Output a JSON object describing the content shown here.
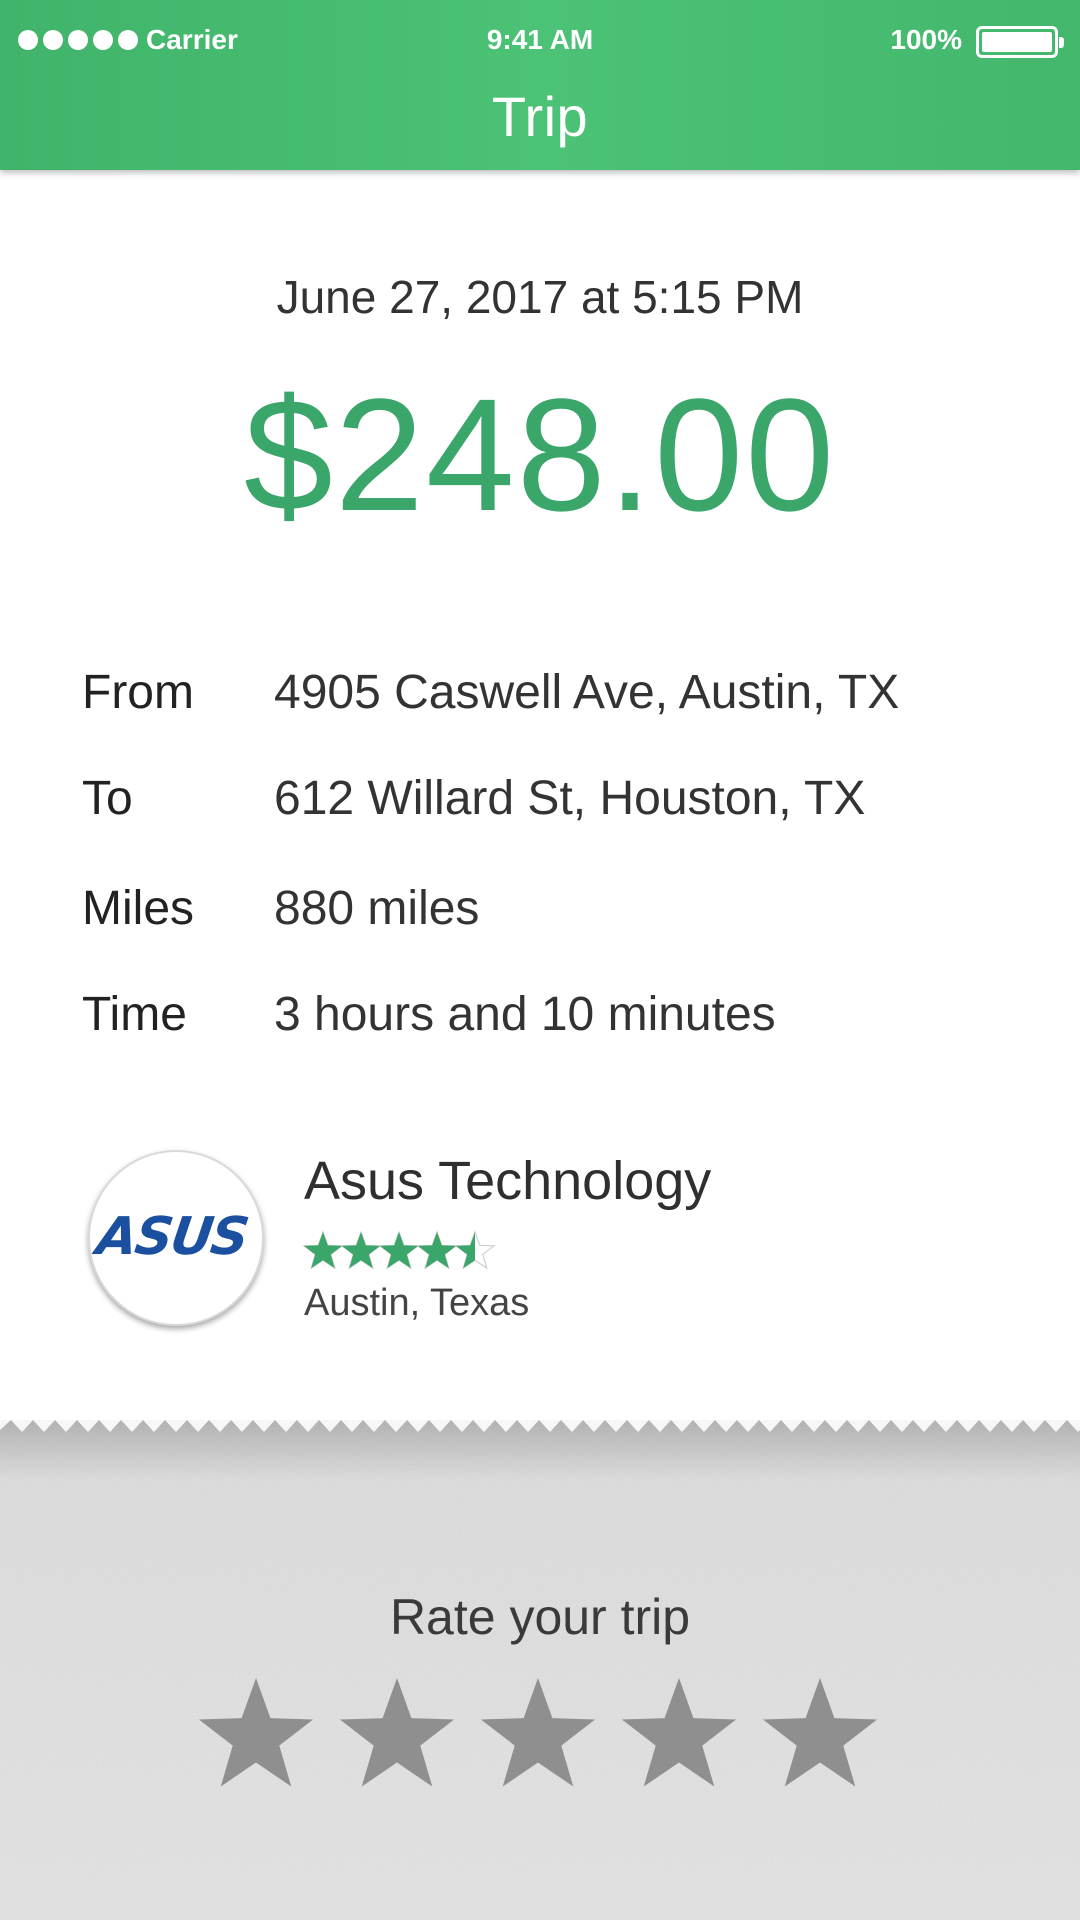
{
  "status_bar": {
    "carrier": "Carrier",
    "time": "9:41 AM",
    "battery": "100%",
    "signal_dots": 5
  },
  "nav": {
    "title": "Trip"
  },
  "trip": {
    "datetime": "June 27, 2017 at 5:15 PM",
    "price": "$248.00",
    "details": [
      {
        "label": "From",
        "value": "4905 Caswell Ave, Austin, TX"
      },
      {
        "label": "To",
        "value": "612 Willard St, Houston, TX"
      },
      {
        "label": "Miles",
        "value": "880 miles"
      },
      {
        "label": "Time",
        "value": "3 hours and 10 minutes"
      }
    ]
  },
  "company": {
    "name": "Asus Technology",
    "logo_text": "ASUS",
    "rating": 4.5,
    "rating_max": 5,
    "location": "Austin, Texas"
  },
  "rate": {
    "title": "Rate your trip",
    "stars": 5,
    "selected": 0
  },
  "colors": {
    "header_green": "#47be73",
    "price_green": "#3aa66a",
    "star_green": "#3aa66a",
    "star_gray": "#8f8f8f",
    "logo_blue": "#1b4fa0",
    "paper_gray": "#e7e7e7"
  }
}
